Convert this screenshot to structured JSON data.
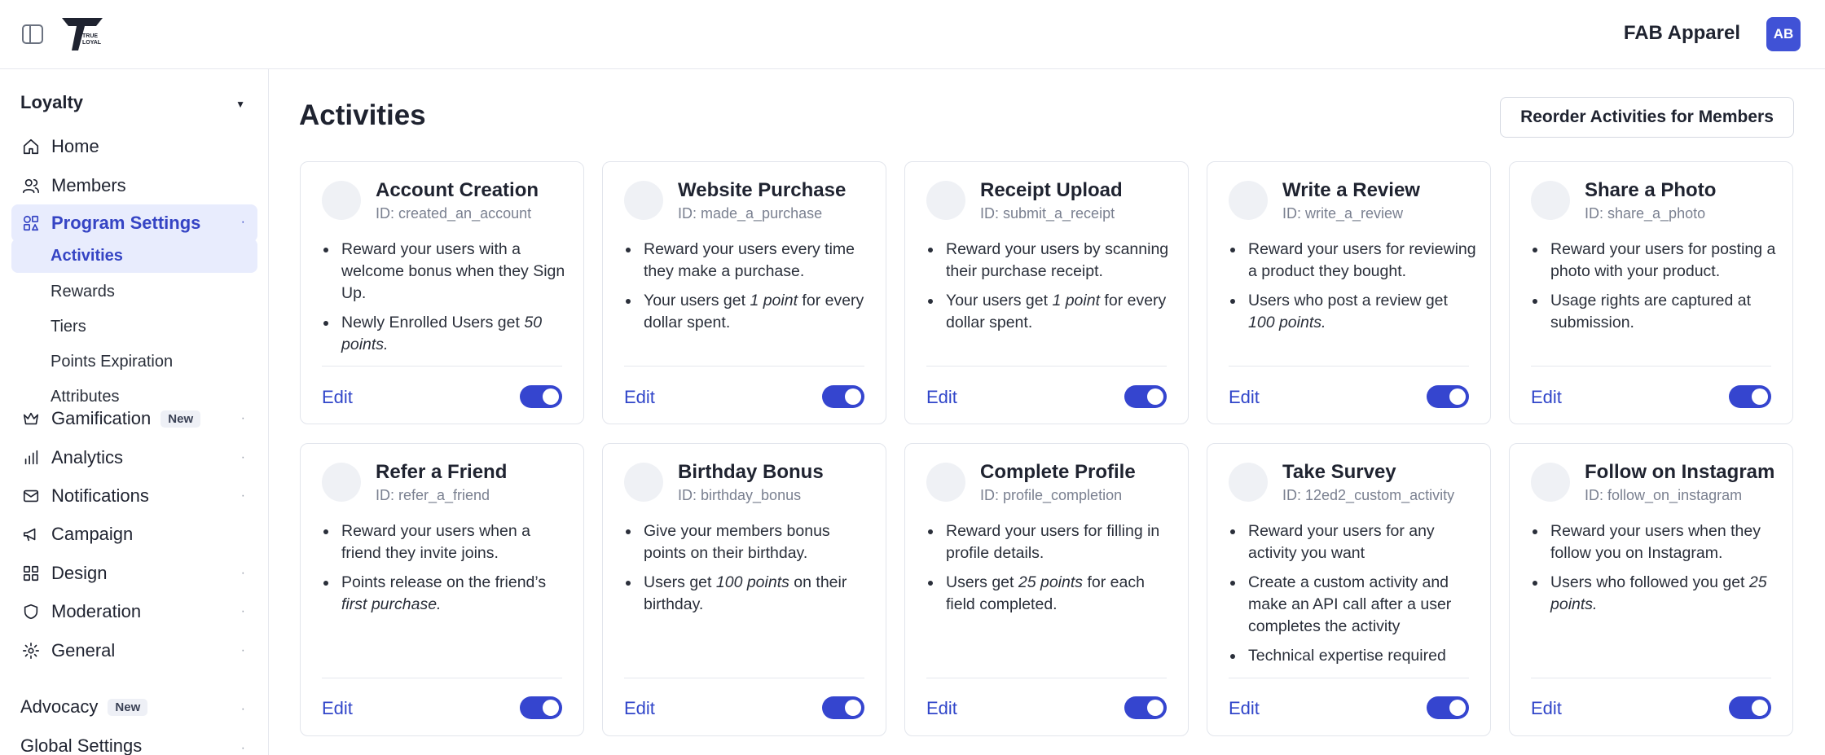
{
  "org": {
    "name": "FAB Apparel",
    "avatar_initials": "AB"
  },
  "sidebar": {
    "loyalty_label": "Loyalty",
    "items": [
      {
        "label": "Home",
        "icon": "home-icon"
      },
      {
        "label": "Members",
        "icon": "users-icon"
      },
      {
        "label": "Program Settings",
        "icon": "shapes-icon"
      }
    ],
    "sub_items": [
      "Activities",
      "Rewards",
      "Tiers",
      "Points Expiration",
      "Attributes"
    ],
    "more_items": [
      {
        "label": "Gamification",
        "icon": "crown-icon",
        "badge": "New"
      },
      {
        "label": "Analytics",
        "icon": "bar-chart-icon"
      },
      {
        "label": "Notifications",
        "icon": "mail-icon"
      },
      {
        "label": "Campaign",
        "icon": "megaphone-icon"
      },
      {
        "label": "Design",
        "icon": "grid-icon"
      },
      {
        "label": "Moderation",
        "icon": "shield-icon"
      },
      {
        "label": "General",
        "icon": "gear-icon"
      }
    ],
    "advocacy_label": "Advocacy",
    "advocacy_badge": "New",
    "global_settings_label": "Global Settings"
  },
  "main": {
    "title": "Activities",
    "reorder_label": "Reorder Activities for Members",
    "edit_label": "Edit",
    "cards": [
      {
        "title": "Account Creation",
        "id": "ID: created_an_account",
        "enabled": true,
        "bullets": [
          [
            {
              "t": "Reward your users with a welcome bonus when they Sign Up."
            }
          ],
          [
            {
              "t": "Newly Enrolled Users get "
            },
            {
              "t": "50 points.",
              "i": true
            }
          ]
        ]
      },
      {
        "title": "Website Purchase",
        "id": "ID: made_a_purchase",
        "enabled": true,
        "bullets": [
          [
            {
              "t": "Reward your users every time they make a purchase."
            }
          ],
          [
            {
              "t": "Your users get "
            },
            {
              "t": "1 point",
              "i": true
            },
            {
              "t": " for every dollar spent."
            }
          ]
        ]
      },
      {
        "title": "Receipt Upload",
        "id": "ID: submit_a_receipt",
        "enabled": true,
        "bullets": [
          [
            {
              "t": "Reward your users by scanning their purchase receipt."
            }
          ],
          [
            {
              "t": "Your users get "
            },
            {
              "t": "1 point",
              "i": true
            },
            {
              "t": " for every dollar spent."
            }
          ]
        ]
      },
      {
        "title": "Write a Review",
        "id": "ID: write_a_review",
        "enabled": true,
        "bullets": [
          [
            {
              "t": "Reward your users for reviewing a product they bought."
            }
          ],
          [
            {
              "t": "Users who post a review get "
            },
            {
              "t": "100 points.",
              "i": true
            }
          ]
        ]
      },
      {
        "title": "Share a Photo",
        "id": "ID: share_a_photo",
        "enabled": true,
        "bullets": [
          [
            {
              "t": "Reward your users for posting a photo with your product."
            }
          ],
          [
            {
              "t": "Usage rights are captured at submission."
            }
          ]
        ]
      },
      {
        "title": "Refer a Friend",
        "id": "ID: refer_a_friend",
        "enabled": true,
        "bullets": [
          [
            {
              "t": "Reward your users when a friend they invite joins."
            }
          ],
          [
            {
              "t": "Points release on the friend’s "
            },
            {
              "t": "first purchase.",
              "i": true
            }
          ]
        ]
      },
      {
        "title": "Birthday Bonus",
        "id": "ID: birthday_bonus",
        "enabled": true,
        "bullets": [
          [
            {
              "t": "Give your members bonus points on their birthday."
            }
          ],
          [
            {
              "t": "Users get "
            },
            {
              "t": "100 points",
              "i": true
            },
            {
              "t": " on their birthday."
            }
          ]
        ]
      },
      {
        "title": "Complete Profile",
        "id": "ID: profile_completion",
        "enabled": true,
        "bullets": [
          [
            {
              "t": "Reward your users for filling in profile details."
            }
          ],
          [
            {
              "t": "Users get "
            },
            {
              "t": "25 points",
              "i": true
            },
            {
              "t": " for each field completed."
            }
          ]
        ]
      },
      {
        "title": "Take Survey",
        "id": "ID: 12ed2_custom_activity",
        "enabled": true,
        "bullets": [
          [
            {
              "t": "Reward your users for any activity you want"
            }
          ],
          [
            {
              "t": "Create a custom activity and make an API call after a user completes the activity"
            }
          ],
          [
            {
              "t": "Technical expertise required"
            }
          ]
        ]
      },
      {
        "title": "Follow on Instagram",
        "id": "ID: follow_on_instagram",
        "enabled": true,
        "bullets": [
          [
            {
              "t": "Reward your users when they follow you on Instagram."
            }
          ],
          [
            {
              "t": "Users who followed you get "
            },
            {
              "t": "25 points.",
              "i": true
            }
          ]
        ]
      }
    ]
  }
}
